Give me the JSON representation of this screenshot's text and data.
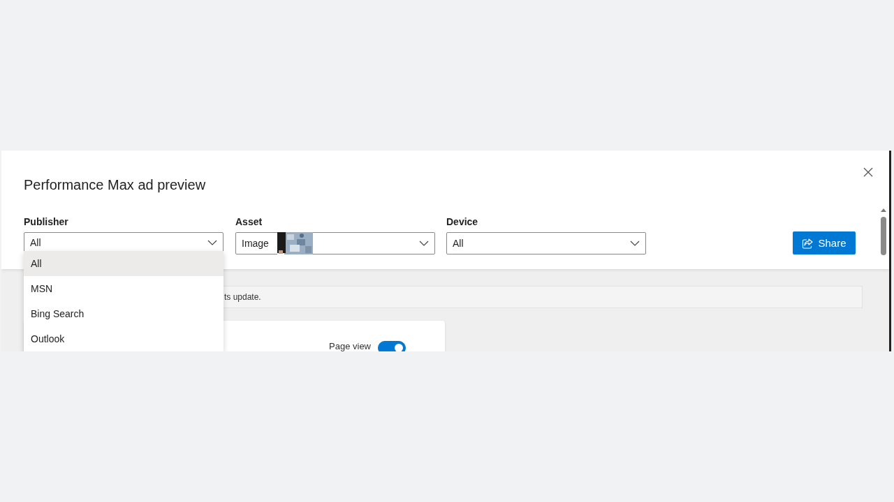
{
  "dialog": {
    "title": "Performance Max ad preview"
  },
  "filters": [
    {
      "label": "Publisher",
      "value": "All",
      "open": true
    },
    {
      "label": "Asset",
      "value": "Image",
      "open": false
    },
    {
      "label": "Device",
      "value": "All",
      "open": false
    }
  ],
  "share_button": "Share",
  "publisher_options": [
    {
      "label": "All",
      "selected": true
    },
    {
      "label": "MSN",
      "selected": false
    },
    {
      "label": "Bing Search",
      "selected": false
    },
    {
      "label": "Outlook",
      "selected": false
    }
  ],
  "notice": "ts update.",
  "card": {
    "toggle_label": "Page view",
    "on": true
  }
}
